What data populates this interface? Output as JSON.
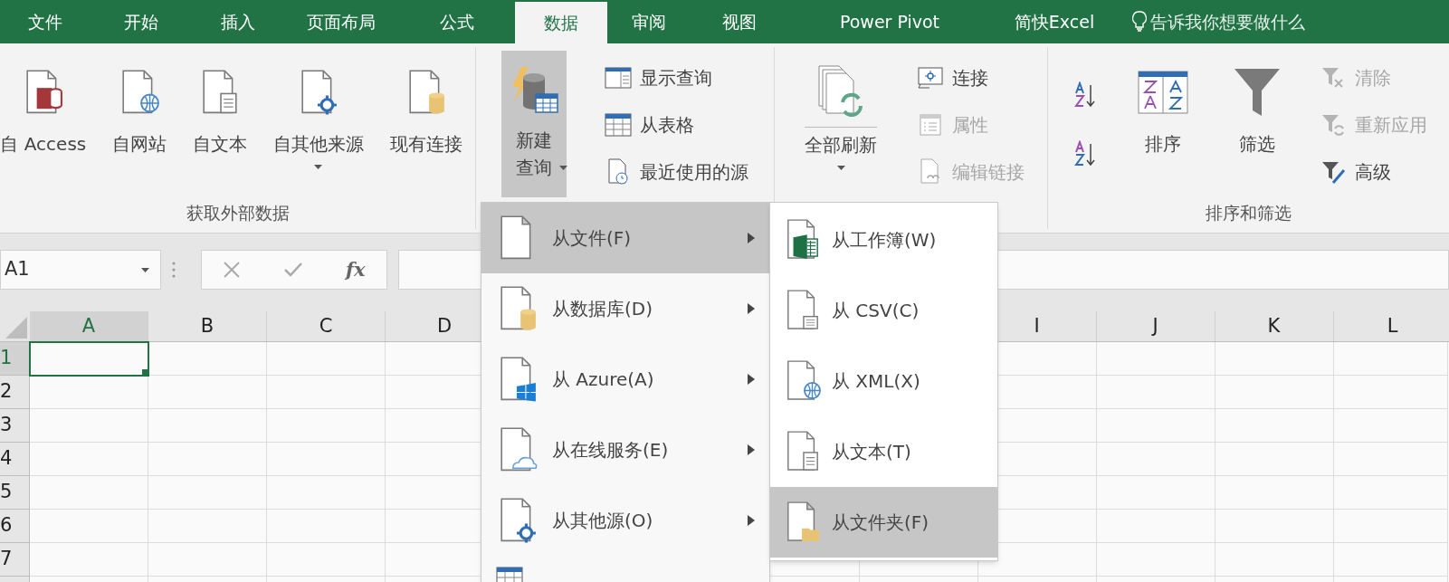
{
  "ribbon_tabs": [
    {
      "label": "文件",
      "selected": false
    },
    {
      "label": "开始",
      "selected": false
    },
    {
      "label": "插入",
      "selected": false
    },
    {
      "label": "页面布局",
      "selected": false
    },
    {
      "label": "公式",
      "selected": false
    },
    {
      "label": "数据",
      "selected": true
    },
    {
      "label": "审阅",
      "selected": false
    },
    {
      "label": "视图",
      "selected": false
    },
    {
      "label": "Power Pivot",
      "selected": false
    },
    {
      "label": "简快Excel",
      "selected": false
    }
  ],
  "tell_me": {
    "label": "告诉我你想要做什么"
  },
  "ribbon_groups": [
    {
      "label": "获取外部数据",
      "columns": [
        {
          "kind": "large",
          "label": "自 Access",
          "dropdown": false,
          "pressed": false
        },
        {
          "kind": "large",
          "label": "自网站",
          "dropdown": false,
          "pressed": false
        },
        {
          "kind": "large",
          "label": "自文本",
          "dropdown": false,
          "pressed": false
        },
        {
          "kind": "large",
          "label": "自其他来源",
          "dropdown": true,
          "pressed": false
        },
        {
          "kind": "large",
          "label": "现有连接",
          "dropdown": false,
          "pressed": false
        }
      ]
    },
    {
      "columns": [
        {
          "kind": "large",
          "label": "新建查询",
          "dropdown": true,
          "pressed": true
        },
        {
          "kind": "stack",
          "items": [
            {
              "label": "显示查询",
              "disabled": false
            },
            {
              "label": "从表格",
              "disabled": false
            },
            {
              "label": "最近使用的源",
              "disabled": false
            }
          ]
        }
      ]
    },
    {
      "columns": [
        {
          "kind": "large",
          "label": "全部刷新",
          "dropdown": true,
          "pressed": false
        },
        {
          "kind": "stack",
          "items": [
            {
              "label": "连接",
              "disabled": false
            },
            {
              "label": "属性",
              "disabled": true
            },
            {
              "label": "编辑链接",
              "disabled": true
            }
          ]
        }
      ]
    },
    {
      "label": "排序和筛选",
      "columns": [
        {
          "kind": "icons",
          "items": [
            {
              "kind": "ascending"
            },
            {
              "kind": "descending"
            }
          ]
        },
        {
          "kind": "large",
          "label": "排序",
          "dropdown": false,
          "pressed": false
        },
        {
          "kind": "large",
          "label": "筛选",
          "dropdown": false,
          "pressed": false
        },
        {
          "kind": "stack",
          "items": [
            {
              "label": "清除",
              "disabled": true
            },
            {
              "label": "重新应用",
              "disabled": true
            },
            {
              "label": "高级",
              "disabled": false
            }
          ]
        }
      ]
    }
  ],
  "name_box": {
    "value": "A1"
  },
  "formula_buttons": {
    "function_label": "fx"
  },
  "columns_left": [
    {
      "label": "A",
      "selected": true
    },
    {
      "label": "B",
      "selected": false
    },
    {
      "label": "C",
      "selected": false
    },
    {
      "label": "D",
      "selected": false
    }
  ],
  "columns_right": [
    {
      "label": "I",
      "selected": false
    },
    {
      "label": "J",
      "selected": false
    },
    {
      "label": "K",
      "selected": false
    },
    {
      "label": "L",
      "selected": false
    }
  ],
  "rows": [
    {
      "label": "1",
      "selected": true
    },
    {
      "label": "2",
      "selected": false
    },
    {
      "label": "3",
      "selected": false
    },
    {
      "label": "4",
      "selected": false
    },
    {
      "label": "5",
      "selected": false
    },
    {
      "label": "6",
      "selected": false
    },
    {
      "label": "7",
      "selected": false
    }
  ],
  "menu": {
    "items": [
      {
        "label": "从文件(F)",
        "selected": true,
        "submenu": true
      },
      {
        "label": "从数据库(D)",
        "selected": false,
        "submenu": true
      },
      {
        "label": "从 Azure(A)",
        "selected": false,
        "submenu": true
      },
      {
        "label": "从在线服务(E)",
        "selected": false,
        "submenu": true
      },
      {
        "label": "从其他源(O)",
        "selected": false,
        "submenu": true
      }
    ]
  },
  "submenu": {
    "items": [
      {
        "label": "从工作簿(W)",
        "selected": false
      },
      {
        "label": "从 CSV(C)",
        "selected": false
      },
      {
        "label": "从 XML(X)",
        "selected": false
      },
      {
        "label": "从文本(T)",
        "selected": false
      },
      {
        "label": "从文件夹(F)",
        "selected": true
      }
    ]
  }
}
